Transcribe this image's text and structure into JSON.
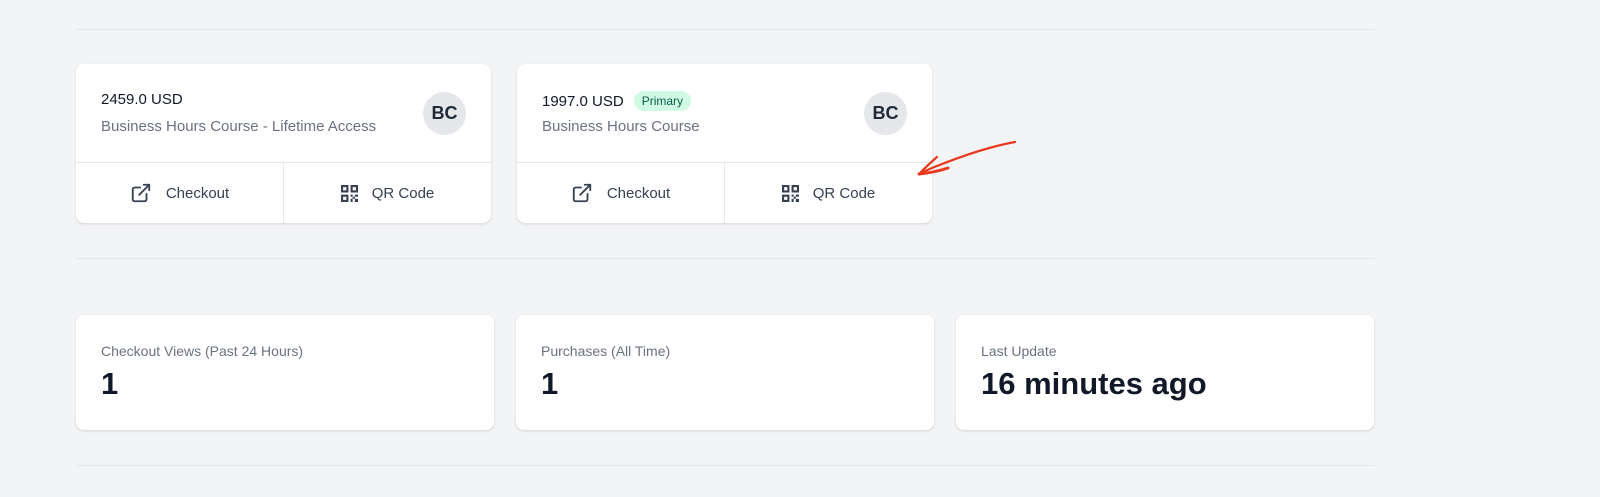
{
  "price_cards": [
    {
      "amount": "2459.0 USD",
      "name": "Business Hours Course - Lifetime Access",
      "badge": "",
      "avatar": "BC",
      "checkout_label": "Checkout",
      "qr_label": "QR Code"
    },
    {
      "amount": "1997.0 USD",
      "name": "Business Hours Course",
      "badge": "Primary",
      "avatar": "BC",
      "checkout_label": "Checkout",
      "qr_label": "QR Code"
    }
  ],
  "stats": [
    {
      "label": "Checkout Views (Past 24 Hours)",
      "value": "1"
    },
    {
      "label": "Purchases (All Time)",
      "value": "1"
    },
    {
      "label": "Last Update",
      "value": "16 minutes ago"
    }
  ],
  "icons": {
    "checkout": "external-link-icon",
    "qr": "qr-code-icon",
    "annotation": "red-arrow-annotation"
  },
  "colors": {
    "badge_bg": "#d1fae5",
    "badge_text": "#065f46",
    "annotation": "#e8391e"
  }
}
